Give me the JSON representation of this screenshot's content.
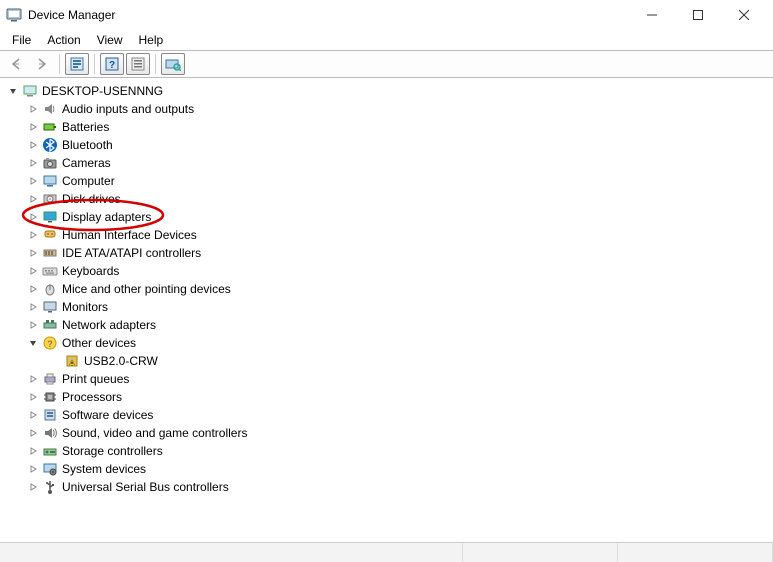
{
  "window": {
    "title": "Device Manager"
  },
  "menu": {
    "file": "File",
    "action": "Action",
    "view": "View",
    "help": "Help"
  },
  "toolbar": {
    "back": "back",
    "forward": "forward",
    "show_hidden": "show-hidden",
    "help": "help",
    "properties": "properties",
    "scan": "scan"
  },
  "tree": {
    "root": "DESKTOP-USENNNG",
    "items": [
      {
        "label": "Audio inputs and outputs",
        "icon": "speaker"
      },
      {
        "label": "Batteries",
        "icon": "battery"
      },
      {
        "label": "Bluetooth",
        "icon": "bluetooth"
      },
      {
        "label": "Cameras",
        "icon": "camera"
      },
      {
        "label": "Computer",
        "icon": "computer"
      },
      {
        "label": "Disk drives",
        "icon": "disk"
      },
      {
        "label": "Display adapters",
        "icon": "display"
      },
      {
        "label": "Human Interface Devices",
        "icon": "hid"
      },
      {
        "label": "IDE ATA/ATAPI controllers",
        "icon": "ide"
      },
      {
        "label": "Keyboards",
        "icon": "keyboard"
      },
      {
        "label": "Mice and other pointing devices",
        "icon": "mouse"
      },
      {
        "label": "Monitors",
        "icon": "monitor"
      },
      {
        "label": "Network adapters",
        "icon": "network"
      },
      {
        "label": "Other devices",
        "icon": "other",
        "expanded": true,
        "children": [
          {
            "label": "USB2.0-CRW",
            "icon": "warning"
          }
        ]
      },
      {
        "label": "Print queues",
        "icon": "printer"
      },
      {
        "label": "Processors",
        "icon": "cpu"
      },
      {
        "label": "Software devices",
        "icon": "software"
      },
      {
        "label": "Sound, video and game controllers",
        "icon": "sound"
      },
      {
        "label": "Storage controllers",
        "icon": "storage"
      },
      {
        "label": "System devices",
        "icon": "system"
      },
      {
        "label": "Universal Serial Bus controllers",
        "icon": "usb"
      }
    ]
  },
  "annotation": {
    "circled_item": "Display adapters",
    "color": "#d40000"
  }
}
